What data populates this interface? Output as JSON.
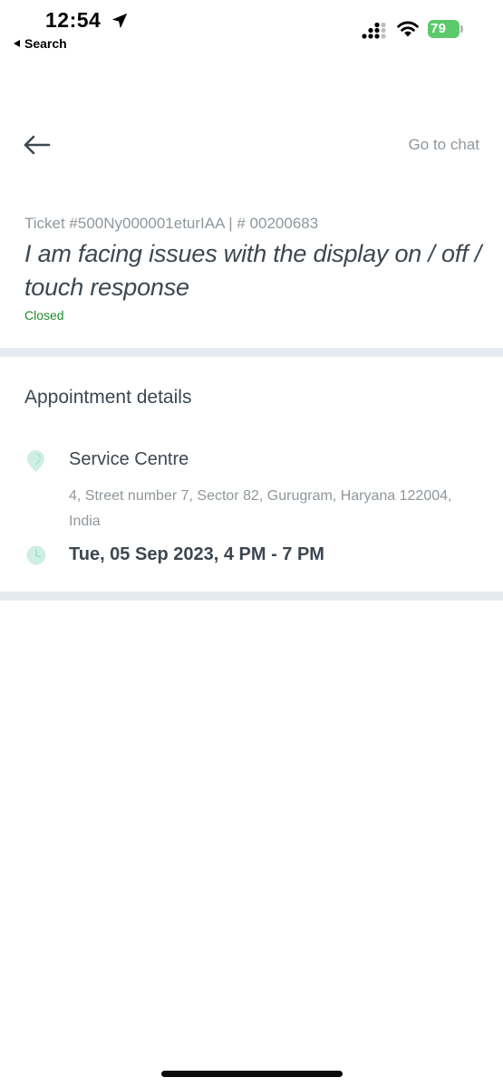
{
  "status_bar": {
    "time": "12:54",
    "back_app_label": "Search",
    "battery_level": "79",
    "battery_color": "#5cc96a"
  },
  "nav": {
    "back_icon": "arrow-left-icon",
    "go_to_chat_label": "Go to chat"
  },
  "ticket": {
    "id_line": "Ticket #500Ny000001eturIAA | # 00200683",
    "title": "I am facing issues with the display on / off / touch response",
    "status": "Closed",
    "status_color": "#1f8a2e"
  },
  "appointment": {
    "section_title": "Appointment details",
    "location_icon": "map-pin-icon",
    "centre_name": "Service Centre",
    "address": "4, Street number 7, Sector 82, Gurugram, Haryana 122004, India",
    "time_icon": "clock-icon",
    "schedule": "Tue, 05 Sep 2023, 4 PM - 7 PM",
    "icon_color": "#cfeee4"
  }
}
